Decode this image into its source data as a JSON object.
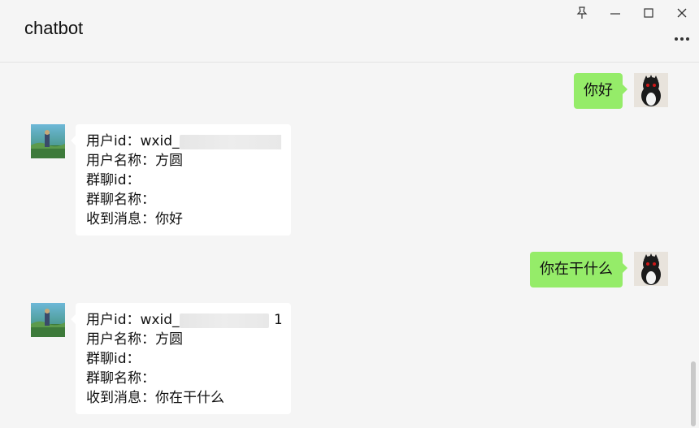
{
  "window": {
    "title": "chatbot",
    "controls": [
      "pin-icon",
      "minimize-icon",
      "maximize-icon",
      "close-icon"
    ],
    "more_icon": "more-icon"
  },
  "messages": [
    {
      "type": "sent",
      "text": "你好",
      "avatar": "penguin-avatar"
    },
    {
      "type": "received",
      "avatar": "landscape-avatar",
      "lines": [
        "用户id：wxid_",
        "用户名称：方圆",
        "群聊id：",
        "群聊名称：",
        "收到消息：你好"
      ],
      "id_suffix": ""
    },
    {
      "type": "sent",
      "text": "你在干什么",
      "avatar": "penguin-avatar"
    },
    {
      "type": "received",
      "avatar": "landscape-avatar",
      "lines": [
        "用户id：wxid_",
        "用户名称：方圆",
        "群聊id：",
        "群聊名称：",
        "收到消息：你在干什么"
      ],
      "id_suffix": "1"
    }
  ],
  "colors": {
    "sent_bubble": "#95ec69",
    "received_bubble": "#ffffff",
    "background": "#f5f5f5"
  }
}
